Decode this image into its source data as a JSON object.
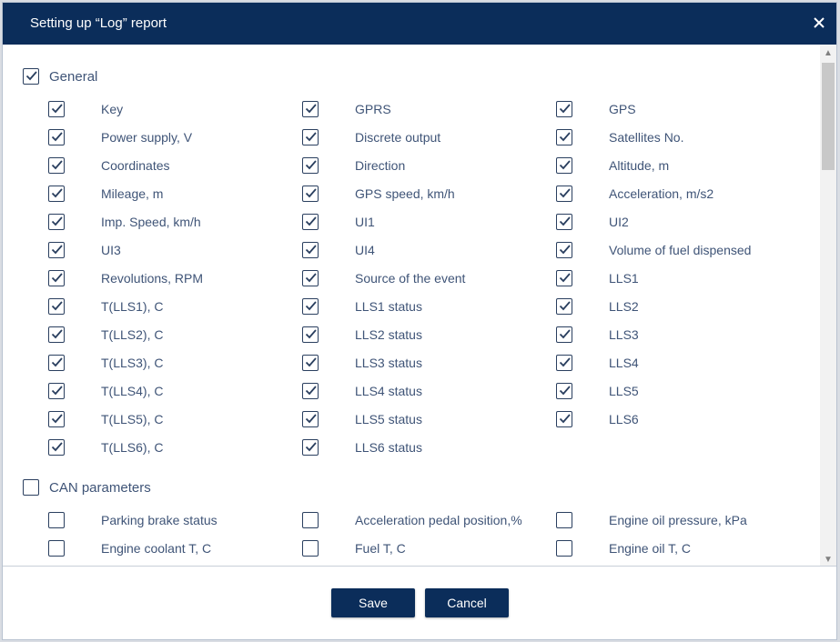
{
  "dialog": {
    "title": "Setting up “Log” report"
  },
  "sections": [
    {
      "label": "General",
      "checked": true,
      "items": [
        {
          "label": "Key",
          "checked": true
        },
        {
          "label": "GPRS",
          "checked": true
        },
        {
          "label": "GPS",
          "checked": true
        },
        {
          "label": "Power supply, V",
          "checked": true
        },
        {
          "label": "Discrete output",
          "checked": true
        },
        {
          "label": "Satellites No.",
          "checked": true
        },
        {
          "label": "Coordinates",
          "checked": true
        },
        {
          "label": "Direction",
          "checked": true
        },
        {
          "label": "Altitude, m",
          "checked": true
        },
        {
          "label": "Mileage, m",
          "checked": true
        },
        {
          "label": "GPS speed, km/h",
          "checked": true
        },
        {
          "label": "Acceleration, m/s2",
          "checked": true
        },
        {
          "label": "Imp. Speed, km/h",
          "checked": true
        },
        {
          "label": "UI1",
          "checked": true
        },
        {
          "label": "UI2",
          "checked": true
        },
        {
          "label": "UI3",
          "checked": true
        },
        {
          "label": "UI4",
          "checked": true
        },
        {
          "label": "Volume of fuel dispensed",
          "checked": true
        },
        {
          "label": "Revolutions, RPM",
          "checked": true
        },
        {
          "label": "Source of the event",
          "checked": true
        },
        {
          "label": "LLS1",
          "checked": true
        },
        {
          "label": "T(LLS1), C",
          "checked": true
        },
        {
          "label": "LLS1 status",
          "checked": true
        },
        {
          "label": "LLS2",
          "checked": true
        },
        {
          "label": "T(LLS2), C",
          "checked": true
        },
        {
          "label": "LLS2 status",
          "checked": true
        },
        {
          "label": "LLS3",
          "checked": true
        },
        {
          "label": "T(LLS3), C",
          "checked": true
        },
        {
          "label": "LLS3 status",
          "checked": true
        },
        {
          "label": "LLS4",
          "checked": true
        },
        {
          "label": "T(LLS4), C",
          "checked": true
        },
        {
          "label": "LLS4 status",
          "checked": true
        },
        {
          "label": "LLS5",
          "checked": true
        },
        {
          "label": "T(LLS5), C",
          "checked": true
        },
        {
          "label": "LLS5 status",
          "checked": true
        },
        {
          "label": "LLS6",
          "checked": true
        },
        {
          "label": "T(LLS6), C",
          "checked": true
        },
        {
          "label": "LLS6 status",
          "checked": true
        }
      ]
    },
    {
      "label": "CAN parameters",
      "checked": false,
      "items": [
        {
          "label": "Parking brake status",
          "checked": false
        },
        {
          "label": "Acceleration pedal position,%",
          "checked": false
        },
        {
          "label": "Engine oil pressure, kPa",
          "checked": false
        },
        {
          "label": "Engine coolant T, C",
          "checked": false
        },
        {
          "label": "Fuel T, C",
          "checked": false
        },
        {
          "label": "Engine oil T, C",
          "checked": false
        },
        {
          "label": "",
          "checked": false
        },
        {
          "label": "",
          "checked": false
        },
        {
          "label": "",
          "checked": false
        }
      ]
    }
  ],
  "footer": {
    "save_label": "Save",
    "cancel_label": "Cancel"
  },
  "colors": {
    "header": "#0b2d5a",
    "text": "#3f5477",
    "checkbox_border": "#2a3f5f"
  },
  "icons": {
    "close": "close-icon",
    "check": "check-icon",
    "scroll_up": "scroll-up-icon",
    "scroll_down": "scroll-down-icon"
  }
}
